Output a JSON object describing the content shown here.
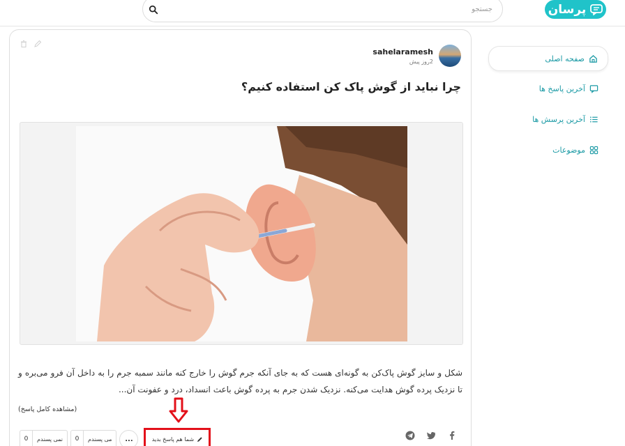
{
  "header": {
    "logo_text": "پرسان",
    "logo_icon": "chat-bubble-icon",
    "search_placeholder": "جستجو",
    "search_icon": "search-icon"
  },
  "sidebar": {
    "items": [
      {
        "label": "صفحه اصلی",
        "icon": "home-icon",
        "active": true
      },
      {
        "label": "آخرین پاسخ ها",
        "icon": "message-icon",
        "active": false
      },
      {
        "label": "آخرین پرسش ها",
        "icon": "list-icon",
        "active": false
      },
      {
        "label": "موضوعات",
        "icon": "grid-icon",
        "active": false
      }
    ]
  },
  "post": {
    "author": "sahelaramesh",
    "time": "2روز پیش",
    "title": "چرا نباید از گوش پاک کن استفاده کنیم؟",
    "answer_text": "شکل و سایز گوش پاک‌کن به گونه‌ای هست که به جای آنکه جرم گوش را خارج کنه مانند سمبه جرم را به داخل آن فرو می‌بره و تا نزدیک پرده گوش هدایت می‌کنه. نزدیک شدن جرم به پرده گوش باعث انسداد، درد و عفونت آن...",
    "more_link": "(مشاهده کامل پاسخ)",
    "answer_button": "شما هم پاسخ بدید",
    "like_label": "می پسندم",
    "like_count": "0",
    "dislike_label": "نمی پسندم",
    "dislike_count": "0",
    "more_label": "..."
  },
  "colors": {
    "brand": "#20c3c9",
    "link": "#1b9aa5",
    "highlight": "#e3101a"
  }
}
